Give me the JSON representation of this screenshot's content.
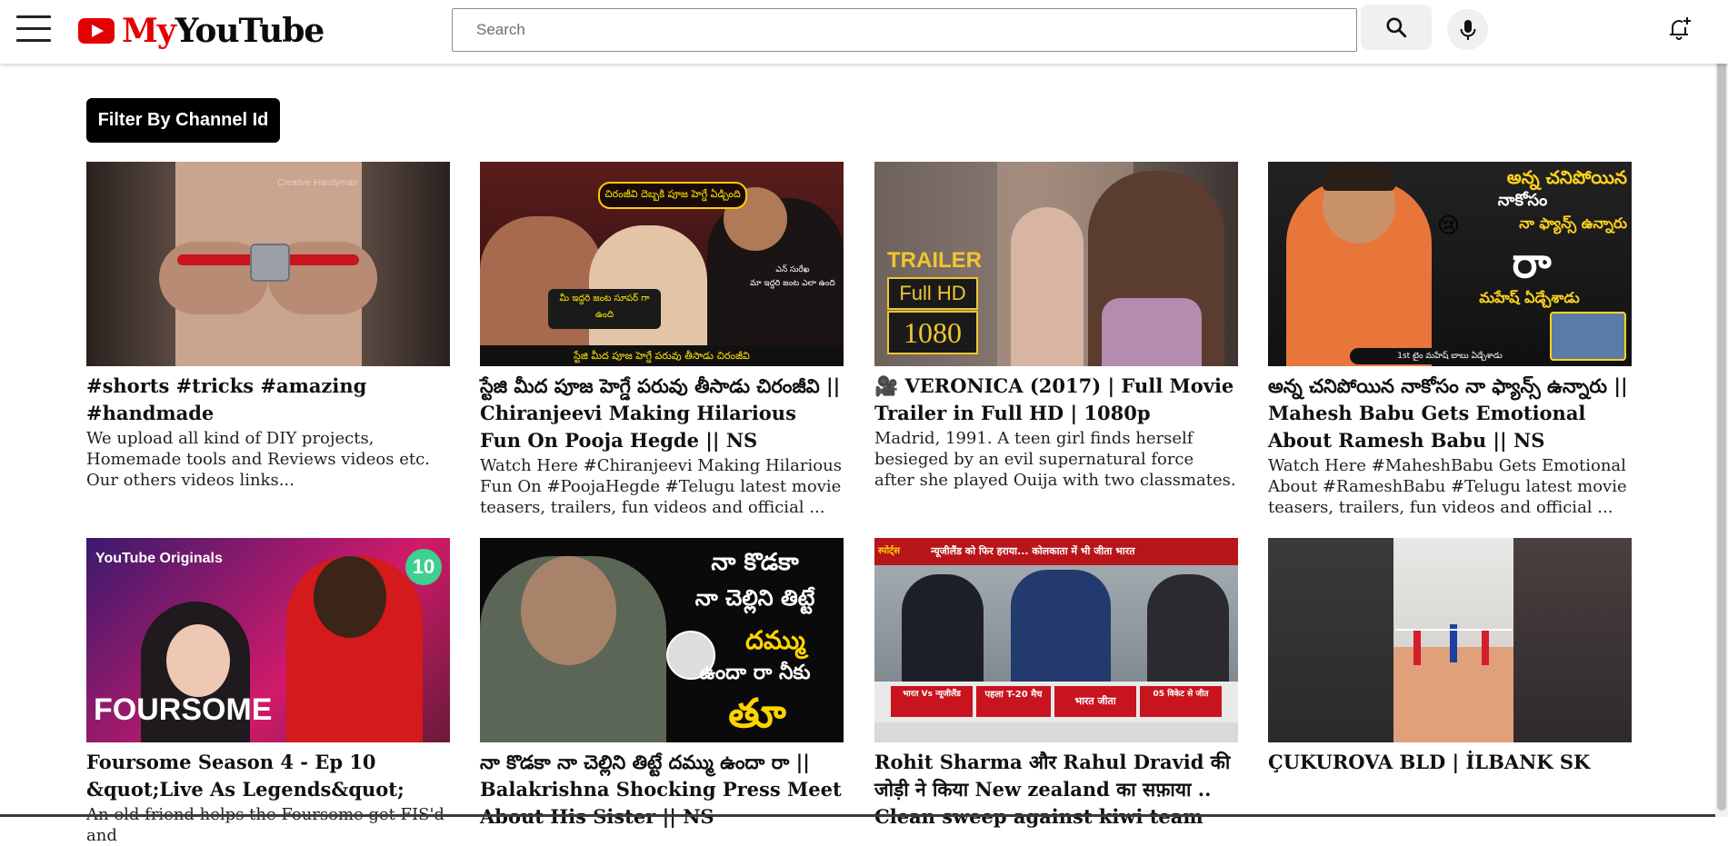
{
  "header": {
    "logo_my": "My",
    "logo_youtube": "YouTube",
    "search_placeholder": "Search",
    "icons": {
      "menu": "hamburger-menu-icon",
      "logo": "youtube-play-icon",
      "search": "search-icon",
      "mic": "microphone-icon",
      "notifications": "bell-plus-icon"
    }
  },
  "filter": {
    "label": "Filter By Channel Id"
  },
  "colors": {
    "brand_red": "#e40000",
    "button_black": "#000000"
  },
  "videos": [
    {
      "title": "#shorts #tricks #amazing #handmade",
      "description": "We upload all kind of DIY projects, Homemade tools and Reviews videos etc. Our others videos links..."
    },
    {
      "title": "స్టేజి మీద పూజ హెగ్డే పరువు తీసాడు చిరంజీవి || Chiranjeevi Making Hilarious Fun On Pooja Hegde || NS",
      "description": "Watch Here #Chiranjeevi Making Hilarious Fun On #PoojaHegde #Telugu latest movie teasers, trailers, fun videos and official ..."
    },
    {
      "title": "🎥 VERONICA (2017) | Full Movie Trailer in Full HD | 1080p",
      "description": "Madrid, 1991. A teen girl finds herself besieged by an evil supernatural force after she played Ouija with two classmates."
    },
    {
      "title": "అన్న చనిపోయిన నాకోసం నా ఫ్యాన్స్ ఉన్నారు || Mahesh Babu Gets Emotional About Ramesh Babu || NS",
      "description": "Watch Here #MaheshBabu Gets Emotional About #RameshBabu #Telugu latest movie teasers, trailers, fun videos and official ..."
    },
    {
      "title": "Foursome Season 4 - Ep 10 &quot;Live As Legends&quot;",
      "description": "An old friend helps the Foursome get FIS'd and"
    },
    {
      "title": "నా కొడకా నా చెల్లిని తిట్టే దమ్ము ఉందా రా || Balakrishna Shocking Press Meet About His Sister || NS",
      "description": ""
    },
    {
      "title": "Rohit Sharma और Rahul Dravid की जोड़ी ने किया New zealand का सफ़ाया .. Clean sweep against kiwi team",
      "description": ""
    },
    {
      "title": "ÇUKUROVA BLD | İLBANK SK",
      "description": ""
    }
  ],
  "thumbnails": {
    "v1": {
      "watermark": "Creative Handyman"
    },
    "v2": {
      "top": "చిరంజీవి దెబ్బకి పూజ హెగ్డే ఏడ్చింది",
      "left": "మీ ఇద్దరి జంట సూపర్ గా ఉంది",
      "right_name": "ఎన్ సురేఖ",
      "right": "మా ఇద్దరి జంట ఎలా ఉంది",
      "bottom": "స్టేజి మీద పూజ హెగ్డే పరువు తీసాడు చిరంజీవి"
    },
    "v3": {
      "line1": "TRAILER",
      "line2": "Full HD",
      "line3": "1080"
    },
    "v4": {
      "line1": "అన్న చనిపోయిన",
      "line2": "నాకోసం",
      "line3": "నా ఫ్యాన్స్ ఉన్నారు",
      "big": "రా",
      "line5": "మహేష్ ఏడ్చేశాడు",
      "bottom": "1st టైం మహేష్ బాబు ఏడ్చేశాడు",
      "emoji": "😢"
    },
    "v5": {
      "badge": "YouTube Originals",
      "number": "10",
      "word": "FOURSOME"
    },
    "v6": {
      "line1": "నా కొడకా",
      "line2": "నా చెల్లిని తిట్టే",
      "line3": "దమ్ము",
      "line4": "ఉందా రా నీకు",
      "big": "తూ"
    },
    "v7": {
      "brand": "स्पोर्ट्स",
      "banner": "न्यूजीलैंड को फिर हराया... कोलकाता में भी जीता भारत",
      "b1": "भारत Vs न्यूजीलैंड",
      "b2": "पहला T-20 मैच",
      "b3": "भारत जीता",
      "b4": "05 विकेट से जीत"
    }
  }
}
